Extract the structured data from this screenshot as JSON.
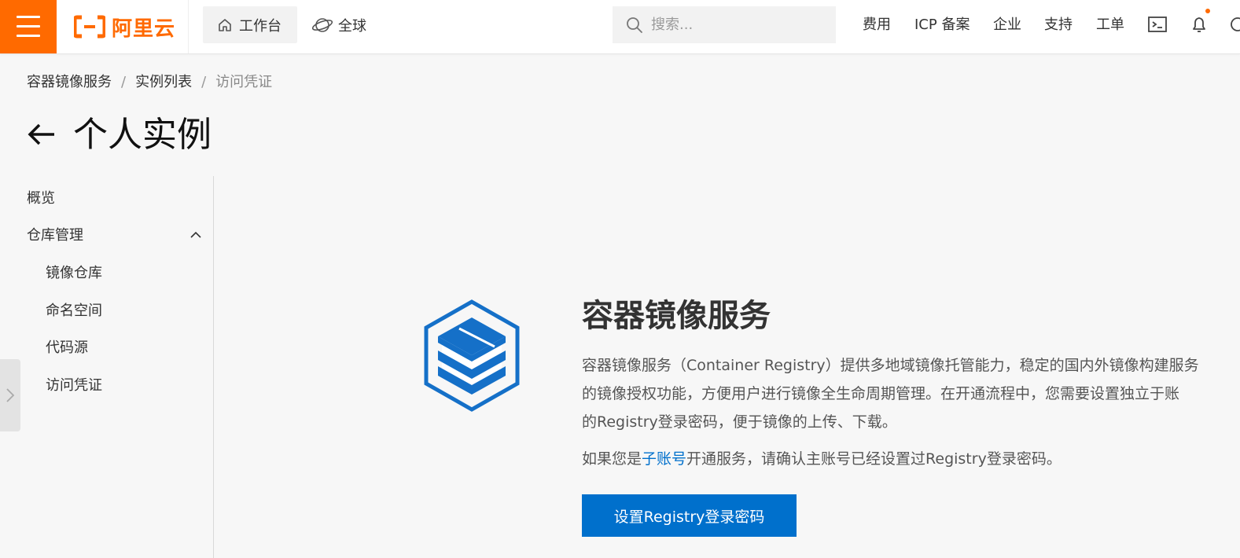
{
  "topbar": {
    "brand": "阿里云",
    "workbench": "工作台",
    "global": "全球",
    "search_placeholder": "搜索...",
    "links": [
      "费用",
      "ICP 备案",
      "企业",
      "支持",
      "工单"
    ],
    "accent_color": "#ff6a00",
    "icons": [
      "menu-icon",
      "aliyun-logo-icon",
      "home-icon",
      "globe-icon",
      "search-icon",
      "terminal-icon",
      "bell-icon"
    ]
  },
  "breadcrumb": {
    "items": [
      "容器镜像服务",
      "实例列表"
    ],
    "current": "访问凭证",
    "separator": "/"
  },
  "page": {
    "title": "个人实例"
  },
  "sidebar": {
    "overview": "概览",
    "repo_management": "仓库管理",
    "children": [
      "镜像仓库",
      "命名空间",
      "代码源",
      "访问凭证"
    ]
  },
  "main": {
    "product_title": "容器镜像服务",
    "description_lines": [
      "容器镜像服务（Container Registry）提供多地域镜像托管能力，稳定的国内外镜像构建服务",
      "的镜像授权功能，方便用户进行镜像全生命周期管理。在开通流程中，您需要设置独立于账",
      "的Registry登录密码，便于镜像的上传、下载。"
    ],
    "note_prefix": "如果您是",
    "note_link": "子账号",
    "note_suffix": "开通服务，请确认主账号已经设置过Registry登录密码。",
    "button_label": "设置Registry登录密码",
    "primary_color": "#0070cc"
  }
}
